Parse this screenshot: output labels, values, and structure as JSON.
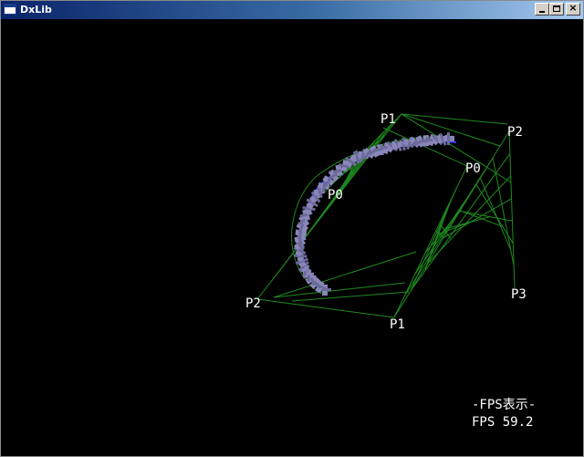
{
  "window": {
    "title": "DxLib",
    "buttons": {
      "minimize": "minimize",
      "maximize": "maximize",
      "close": "×"
    }
  },
  "scene": {
    "curve_a_labels": {
      "p0": "P0",
      "p1": "P1",
      "p2": "P2"
    },
    "curve_b_labels": {
      "p0": "P0",
      "p1": "P1",
      "p2": "P2",
      "p3": "P3"
    },
    "colors": {
      "background": "#000000",
      "control_lines": "#1f8a1f",
      "curve": "#3a3aff",
      "sprites": "#8a86b8",
      "text": "#ffffff"
    }
  },
  "overlay": {
    "fps_title": "-FPS表示-",
    "fps_value": "FPS 59.2"
  }
}
